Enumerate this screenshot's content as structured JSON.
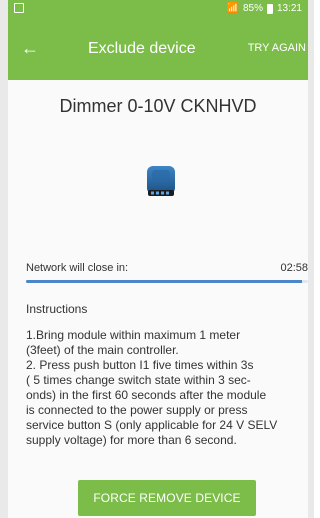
{
  "status_bar": {
    "battery_percent": "85%",
    "time": "13:21",
    "signal_icon": "signal-icon",
    "battery_icon": "battery-icon"
  },
  "appbar": {
    "back_icon": "arrow-left-icon",
    "title": "Exclude device",
    "action": "TRY AGAIN"
  },
  "device": {
    "name": "Dimmer 0-10V CKNHVD",
    "image_icon": "device-module-icon"
  },
  "network": {
    "label": "Network will close in:",
    "time": "02:58",
    "progress": 0.98
  },
  "instructions": {
    "title": "Instructions",
    "lines": [
      "1.Bring module within maximum 1 meter",
      "(3feet) of the main controller.",
      "2. Press push button I1 five times within 3s",
      "( 5 times change switch state within 3 sec-",
      "onds) in the first 60 seconds after the module",
      "is connected to the power supply or press",
      "service button S (only applicable for 24 V SELV",
      "supply voltage) for more than 6 second."
    ]
  },
  "force_button": {
    "label": "FORCE REMOVE DEVICE"
  },
  "colors": {
    "accent": "#7cbd4a",
    "progress": "#4a86c9"
  }
}
